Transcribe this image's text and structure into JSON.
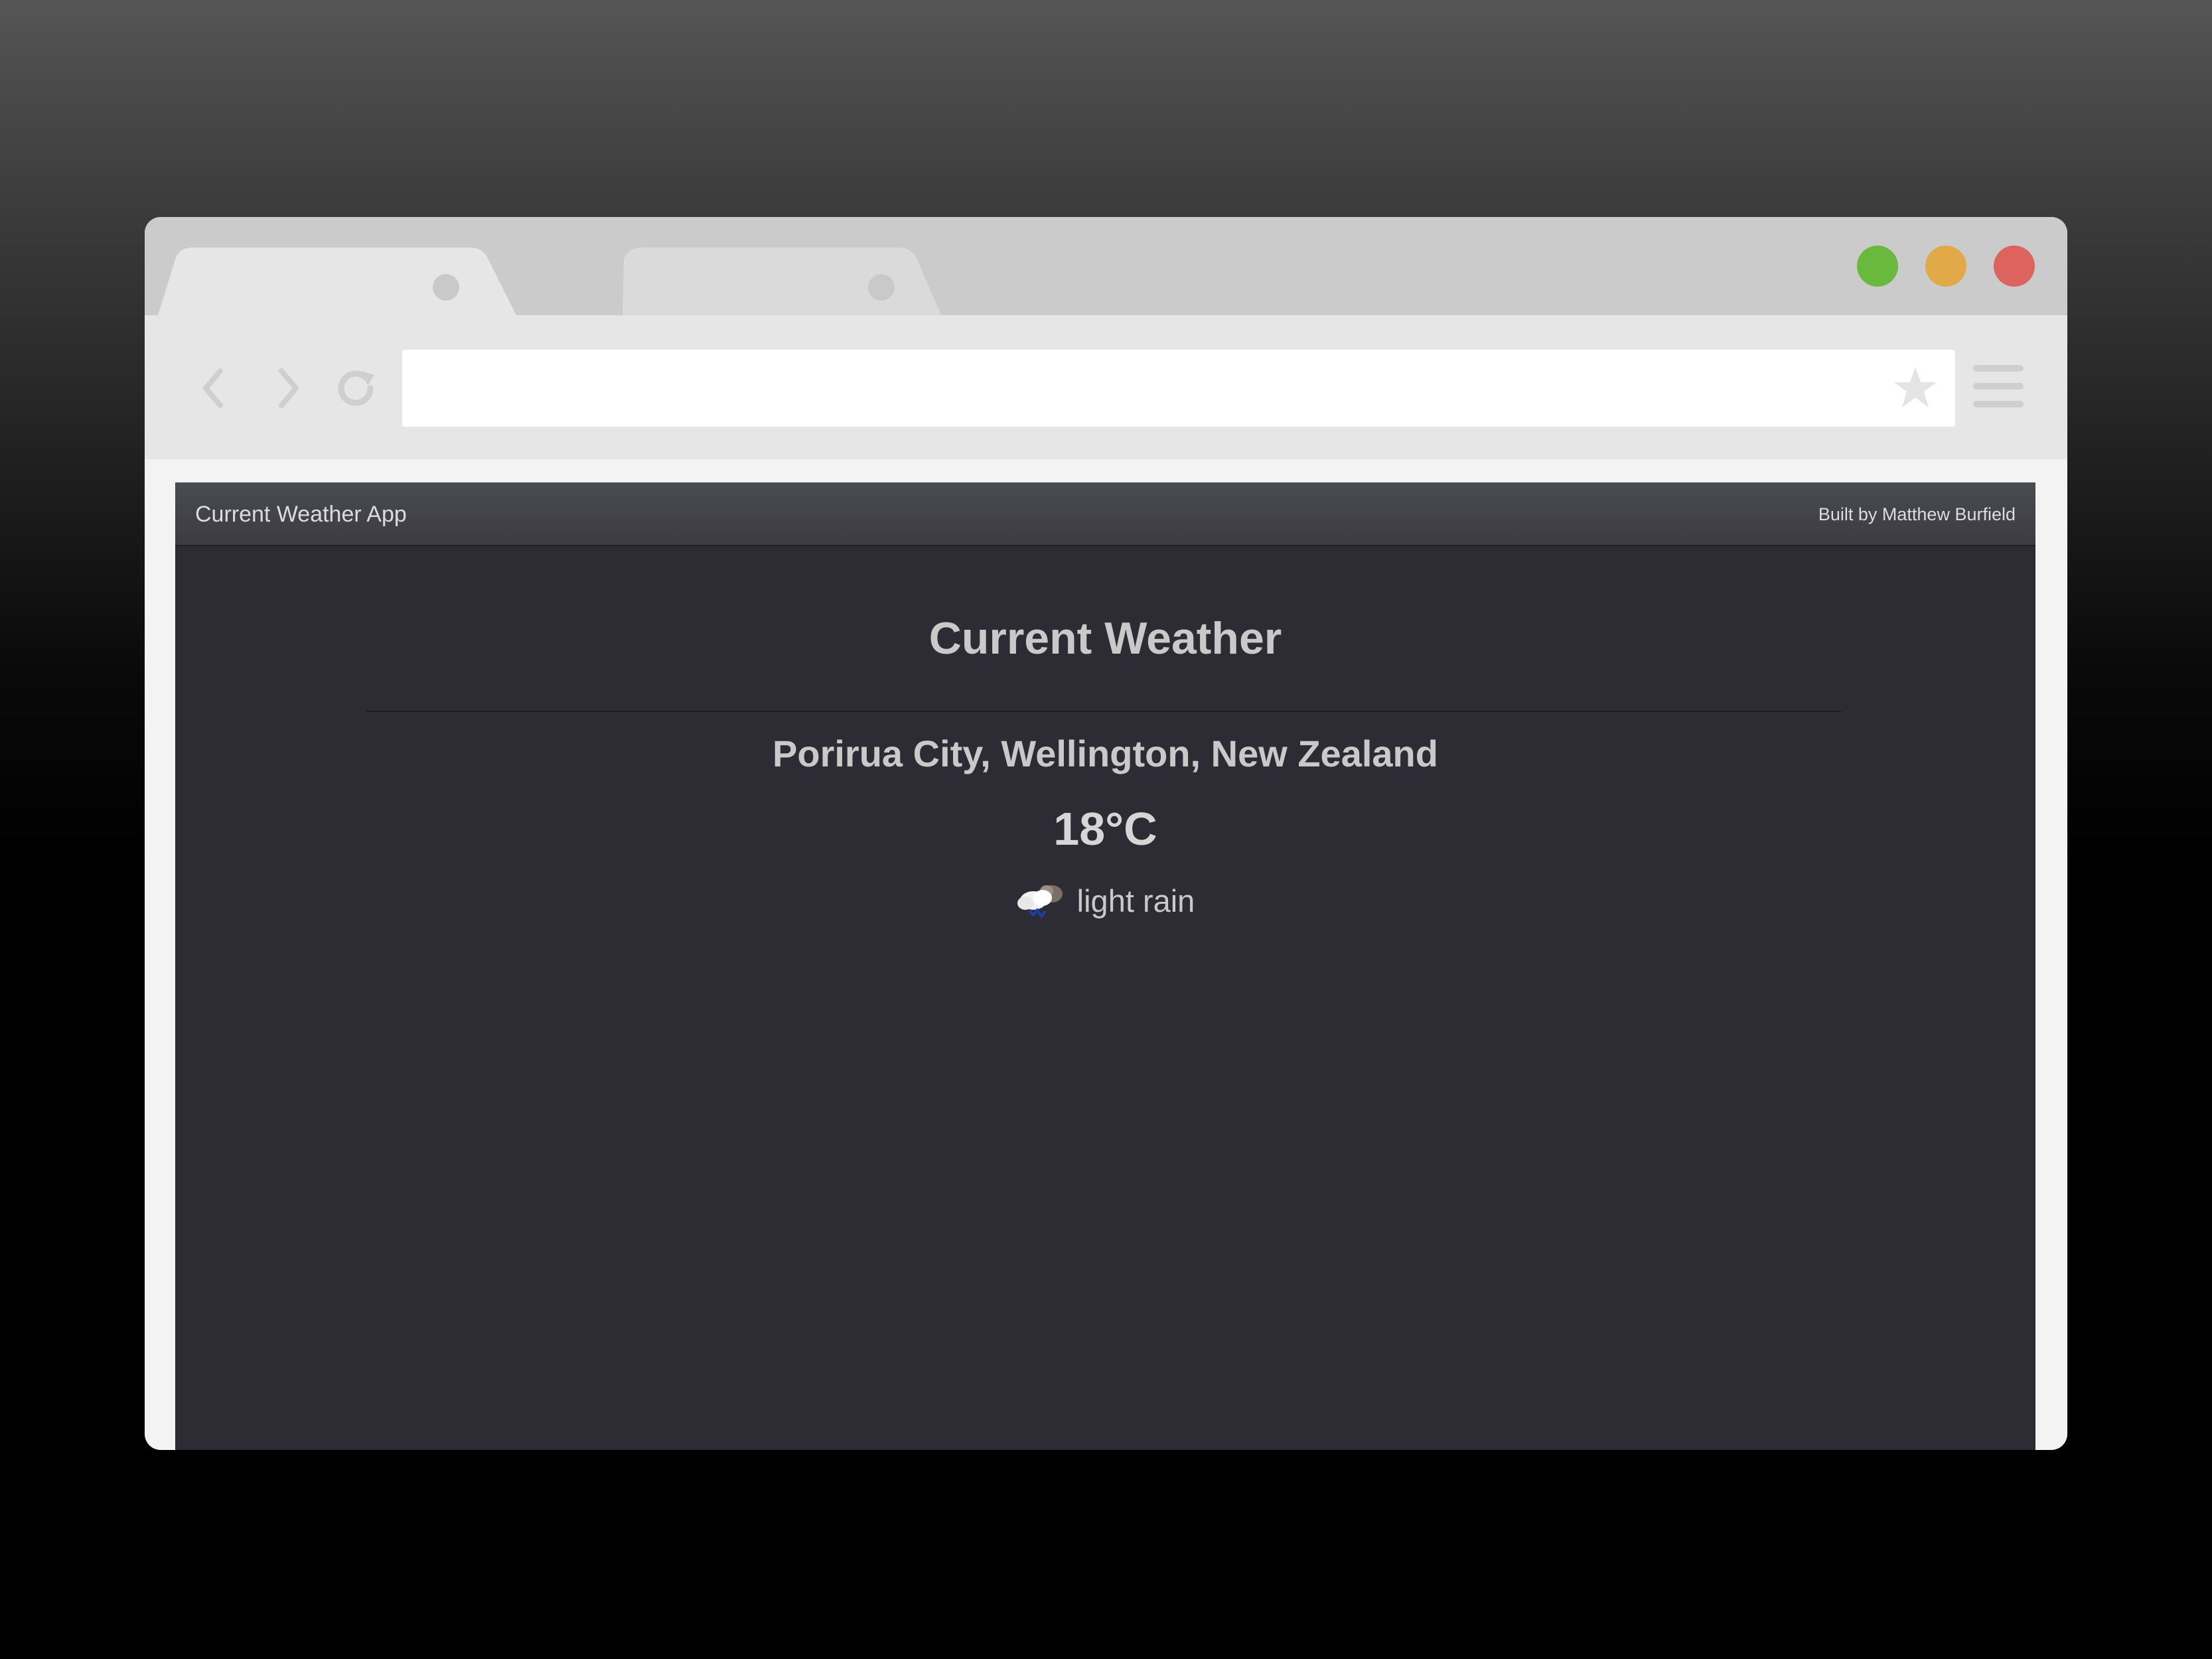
{
  "browser": {
    "tabs": [
      {
        "label": "",
        "active": true
      },
      {
        "label": "",
        "active": false
      }
    ],
    "window_controls": {
      "green": "#6bb83f",
      "yellow": "#e2a948",
      "red": "#dd645e"
    },
    "address_bar": {
      "value": "",
      "placeholder": ""
    }
  },
  "app": {
    "brand": "Current Weather App",
    "credit": "Built by Matthew Burfield",
    "heading": "Current Weather",
    "location": "Porirua City, Wellington, New Zealand",
    "temperature": "18°C",
    "condition": "light rain",
    "condition_icon": "cloud-rain-icon"
  }
}
